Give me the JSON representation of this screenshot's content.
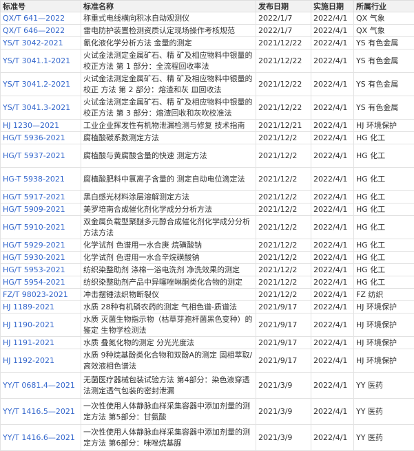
{
  "headers": [
    "标准号",
    "标准名称",
    "发布日期",
    "实施日期",
    "所属行业"
  ],
  "rows": [
    {
      "code": "QX/T 641—2022",
      "name": "称重式电线横向积冰自动观测仪",
      "pub": "2022/1/7",
      "impl": "2022/4/1",
      "industry": "QX 气象"
    },
    {
      "code": "QX/T 646—2022",
      "name": "雷电防护装置检测资质认定现场操作考核规范",
      "pub": "2022/1/7",
      "impl": "2022/4/1",
      "industry": "QX 气象"
    },
    {
      "code": "YS/T 3042-2021",
      "name": "氰化液化学分析方法 金量的测定",
      "pub": "2021/12/22",
      "impl": "2022/4/1",
      "industry": "YS 有色金属"
    },
    {
      "code": "YS/T 3041.1-2021",
      "name": "火试金法测定金属矿石、精 矿及相应物料中银量的校正方法 第 1 部分：全流程回收率法",
      "pub": "2021/12/22",
      "impl": "2022/4/1",
      "industry": "YS 有色金属"
    },
    {
      "code": "YS/T 3041.2-2021",
      "name": "火试金法测定金属矿石、精 矿及相应物料中银量的校正 方法 第 2 部分：熔渣和灰 皿回收法",
      "pub": "2021/12/22",
      "impl": "2022/4/1",
      "industry": "YS 有色金属"
    },
    {
      "code": "YS/T 3041.3-2021",
      "name": "火试金法测定金属矿石、精 矿及相应物料中银量的校正方法 第 3 部分：熔渣回收和灰吹校准法",
      "pub": "2021/12/22",
      "impl": "2022/4/1",
      "industry": "YS 有色金属"
    },
    {
      "code": "HJ 1230—2021",
      "name": "工业企业挥发性有机物泄漏检测与修复 技术指南",
      "pub": "2021/12/21",
      "impl": "2022/4/1",
      "industry": "HJ 环境保护"
    },
    {
      "code": "HG/T 5936-2021",
      "name": "腐植酸碳系数测定方法",
      "pub": "2021/12/2",
      "impl": "2022/4/1",
      "industry": "HG 化工"
    },
    {
      "code": "HG/T 5937-2021",
      "name": "腐植酸与黄腐酸含量的快速 测定方法",
      "pub": "2021/12/2",
      "impl": "2022/4/1",
      "industry": "HG 化工"
    },
    {
      "code": "HG-T 5938-2021",
      "name": "腐植酸肥料中氯离子含量的 测定自动电位滴定法",
      "pub": "2021/12/2",
      "impl": "2022/4/1",
      "industry": "HG 化工"
    },
    {
      "code": "HG/T 5917-2021",
      "name": "黑白感光材料涂层溶解测定方法",
      "pub": "2021/12/2",
      "impl": "2022/4/1",
      "industry": "HG 化工"
    },
    {
      "code": "HG/T 5909-2021",
      "name": "美罗培南合成催化剂化学成分分析方法",
      "pub": "2021/12/2",
      "impl": "2022/4/1",
      "industry": "HG 化工"
    },
    {
      "code": "HG/T 5910-2021",
      "name": "双金属负载型聚醚多元醇合成催化剂化学成分分析方法方法",
      "pub": "2021/12/2",
      "impl": "2022/4/1",
      "industry": "HG 化工"
    },
    {
      "code": "HG/T 5929-2021",
      "name": "化学试剂 色谱用一水合庚 烷磺酸钠",
      "pub": "2021/12/2",
      "impl": "2022/4/1",
      "industry": "HG 化工"
    },
    {
      "code": "HG/T 5930-2021",
      "name": "化学试剂 色谱用一水合辛烷磺酸钠",
      "pub": "2021/12/2",
      "impl": "2022/4/1",
      "industry": "HG 化工"
    },
    {
      "code": "HG/T 5953-2021",
      "name": "纺织染整助剂 涤棉一浴电洗剂 净洗效果的测定",
      "pub": "2021/12/2",
      "impl": "2022/4/1",
      "industry": "HG 化工"
    },
    {
      "code": "HG/T 5954-2021",
      "name": "纺织染整助剂产品中异噻唑啉酮类化合物的测定",
      "pub": "2021/12/2",
      "impl": "2022/4/1",
      "industry": "HG 化工"
    },
    {
      "code": "FZ/T 98023-2021",
      "name": "冲击摆锤法织物断裂仪",
      "pub": "2021/12/2",
      "impl": "2022/4/1",
      "industry": "FZ 纺织"
    },
    {
      "code": "HJ 1189-2021",
      "name": "水质 28种有机磷农药的测定 气相色谱-质谱法",
      "pub": "2021/9/17",
      "impl": "2022/4/1",
      "industry": "HJ 环境保护"
    },
    {
      "code": "HJ 1190-2021",
      "name": "水质 灭菌生物指示物（枯草芽孢杆菌黑色变种）的鉴定 生物学检测法",
      "pub": "2021/9/17",
      "impl": "2022/4/1",
      "industry": "HJ 环境保护"
    },
    {
      "code": "HJ 1191-2021",
      "name": "水质 叠氮化物的测定 分光光度法",
      "pub": "2021/9/17",
      "impl": "2022/4/1",
      "industry": "HJ 环境保护"
    },
    {
      "code": "HJ 1192-2021",
      "name": "水质 9种烷基酚类化合物和双酚A的测定 固相萃取/高效液相色谱法",
      "pub": "2021/9/17",
      "impl": "2022/4/1",
      "industry": "HJ 环境保护"
    },
    {
      "code": "YY/T 0681.4—2021",
      "name": "无菌医疗器械包装试验方法 第4部分：染色液穿透法测定透气包装的密封泄漏",
      "pub": "2021/3/9",
      "impl": "2022/4/1",
      "industry": "YY 医药"
    },
    {
      "code": "YY/T 1416.5—2021",
      "name": "一次性使用人体静脉血样采集容器中添加剂量的测定方法 第5部分：甘氨酸",
      "pub": "2021/3/9",
      "impl": "2022/4/1",
      "industry": "YY 医药"
    },
    {
      "code": "YY/T 1416.6—2021",
      "name": "一次性使用人体静脉血样采集容器中添加剂量的测定方法 第6部分：咪唑烷基脲",
      "pub": "2021/3/9",
      "impl": "2022/4/1",
      "industry": "YY 医药"
    }
  ]
}
